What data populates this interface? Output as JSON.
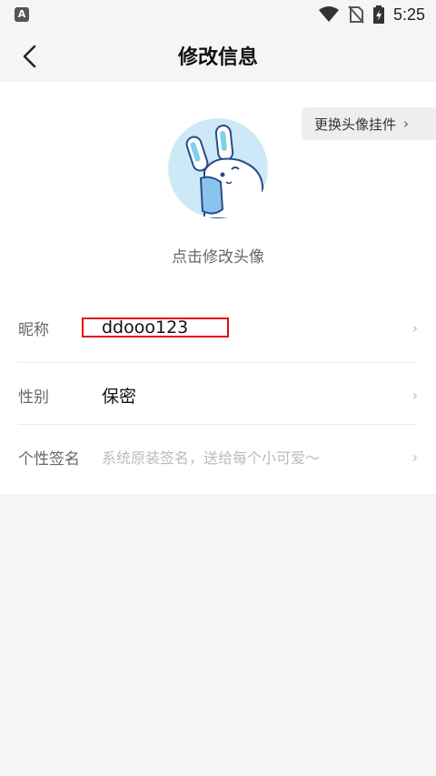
{
  "status_bar": {
    "app_icon_letter": "A",
    "time": "5:25"
  },
  "header": {
    "title": "修改信息"
  },
  "pendant": {
    "label": "更换头像挂件",
    "chevron": "›"
  },
  "avatar": {
    "hint": "点击修改头像",
    "icon": "bunny-avatar"
  },
  "rows": [
    {
      "label": "昵称",
      "value": "ddooo123"
    },
    {
      "label": "性别",
      "value": "保密"
    },
    {
      "label": "个性签名",
      "value": "系统原装签名，送给每个小可爱～"
    }
  ],
  "chevron": "›",
  "colors": {
    "background": "#f5f5f5",
    "card": "#ffffff",
    "highlight_box": "#e01010",
    "avatar_bg": "#cde9f7"
  }
}
